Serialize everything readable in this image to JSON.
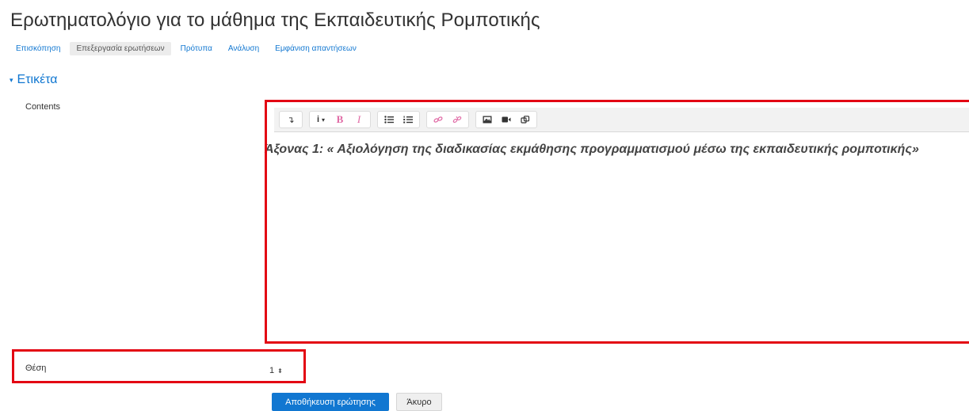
{
  "page": {
    "title": "Ερωτηματολόγιο για το μάθημα της Εκπαιδευτικής Ρομποτικής"
  },
  "tabs": [
    {
      "label": "Επισκόπηση",
      "active": false
    },
    {
      "label": "Επεξεργασία ερωτήσεων",
      "active": true
    },
    {
      "label": "Πρότυπα",
      "active": false
    },
    {
      "label": "Ανάλυση",
      "active": false
    },
    {
      "label": "Εμφάνιση απαντήσεων",
      "active": false
    }
  ],
  "section": {
    "label": "Ετικέτα",
    "caret": "▾"
  },
  "form": {
    "contents_label": "Contents",
    "editor_text": "Άξονας 1: « Αξιολόγηση της διαδικασίας εκμάθησης προγραμματισμού μέσω της εκπαιδευτικής ρομποτικής»",
    "position_label": "Θέση",
    "position_value": "1",
    "position_arrows": "⬍"
  },
  "toolbar": {
    "show_more": "↴",
    "info": "i",
    "info_caret": "▾",
    "bold": "B",
    "italic": "I"
  },
  "buttons": {
    "save": "Αποθήκευση ερώτησης",
    "cancel": "Άκυρο"
  },
  "colors": {
    "link": "#1177d1",
    "highlight_border": "#e30613",
    "primary_button": "#1177d1",
    "toolbar_accent": "#e06aa5"
  }
}
